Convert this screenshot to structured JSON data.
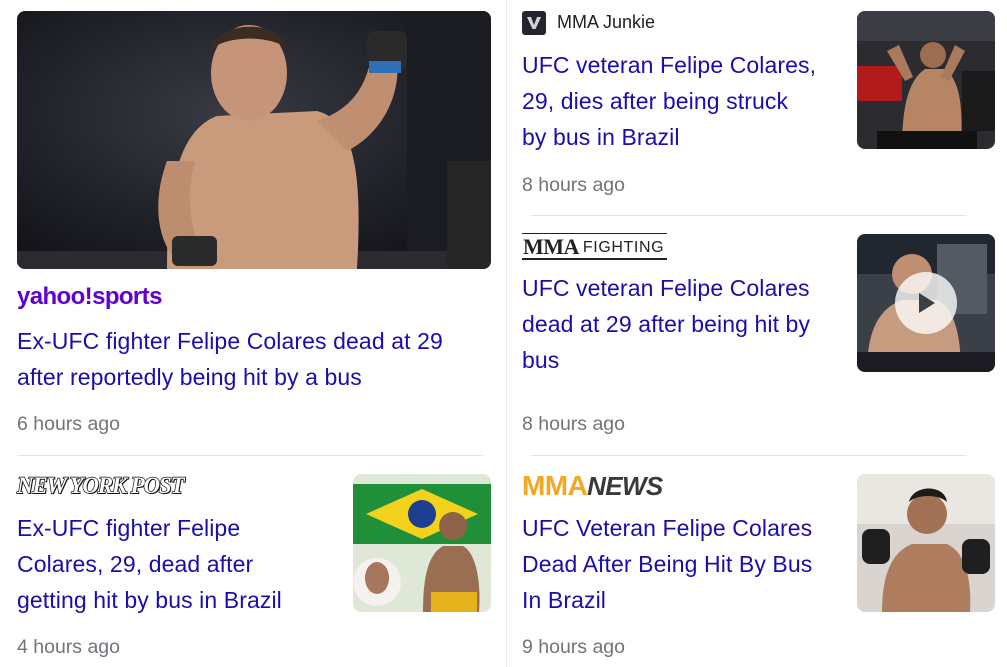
{
  "articles": [
    {
      "source": "yahoo!sports",
      "headline_lines": [
        "Ex-UFC fighter Felipe Colares dead at 29",
        "after reportedly being hit by a bus"
      ],
      "time": "6 hours ago"
    },
    {
      "source": "NEW YORK POST",
      "headline_lines": [
        "Ex-UFC fighter Felipe",
        "Colares, 29, dead after",
        "getting hit by bus in Brazil"
      ],
      "time": "4 hours ago"
    },
    {
      "source": "MMA Junkie",
      "headline_lines": [
        "UFC veteran Felipe Colares,",
        "29, dies after being struck",
        "by bus in Brazil"
      ],
      "time": "8 hours ago"
    },
    {
      "source_a": "MMA",
      "source_b": "FIGHTING",
      "headline_lines": [
        "UFC veteran Felipe Colares",
        "dead at 29 after being hit by",
        "bus"
      ],
      "time": "8 hours ago"
    },
    {
      "source_a": "MMA",
      "source_b": "NEWS",
      "headline_lines": [
        "UFC Veteran Felipe Colares",
        "Dead After Being Hit By Bus",
        "In Brazil"
      ],
      "time": "9 hours ago"
    }
  ],
  "colors": {
    "link": "#1a0dab",
    "meta": "#70757a",
    "yahoo_purple": "#5f01d1",
    "mmanews_orange": "#f5a623"
  }
}
